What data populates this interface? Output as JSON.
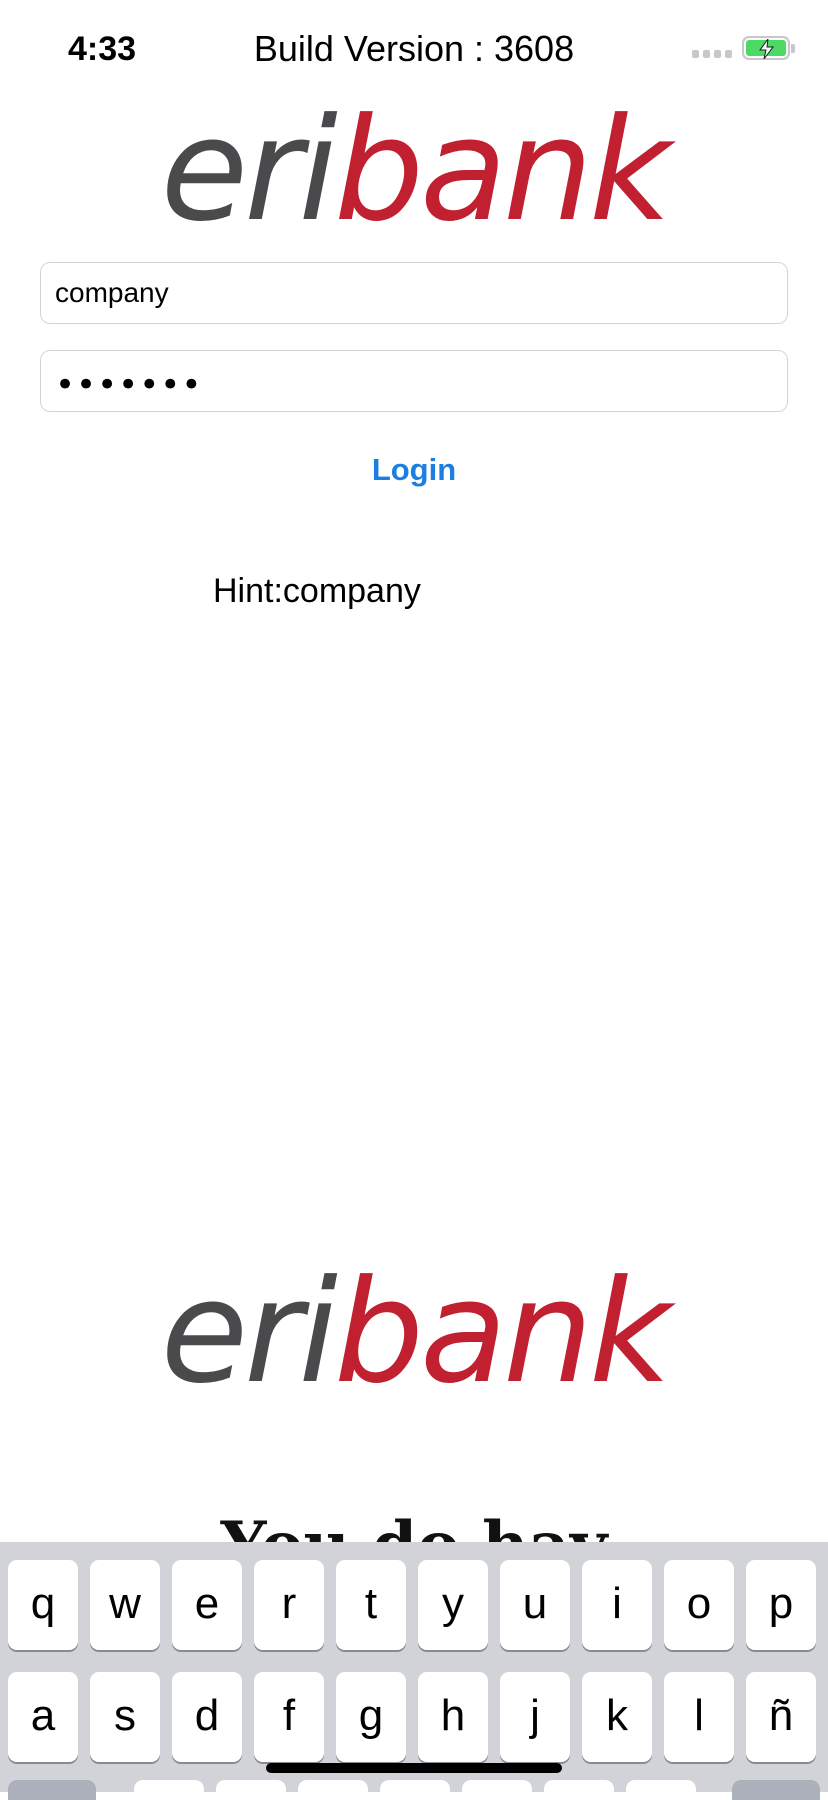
{
  "status_bar": {
    "time": "4:33",
    "build_version": "Build Version : 3608",
    "battery_color": "#4cd964"
  },
  "logo": {
    "eri": "eri",
    "bank": "bank",
    "colors": {
      "eri": "#4a4a4c",
      "bank": "#c0202f"
    }
  },
  "form": {
    "username_value": "company",
    "password_masked": "•••••••",
    "login_label": "Login",
    "hint": "Hint:company"
  },
  "partial_heading": "You do hav",
  "keyboard": {
    "row1": [
      "q",
      "w",
      "e",
      "r",
      "t",
      "y",
      "u",
      "i",
      "o",
      "p"
    ],
    "row2": [
      "a",
      "s",
      "d",
      "f",
      "g",
      "h",
      "j",
      "k",
      "l",
      "ñ"
    ]
  },
  "colors": {
    "accent": "#1a7fe0",
    "keyboard_bg": "#d1d3d9"
  }
}
